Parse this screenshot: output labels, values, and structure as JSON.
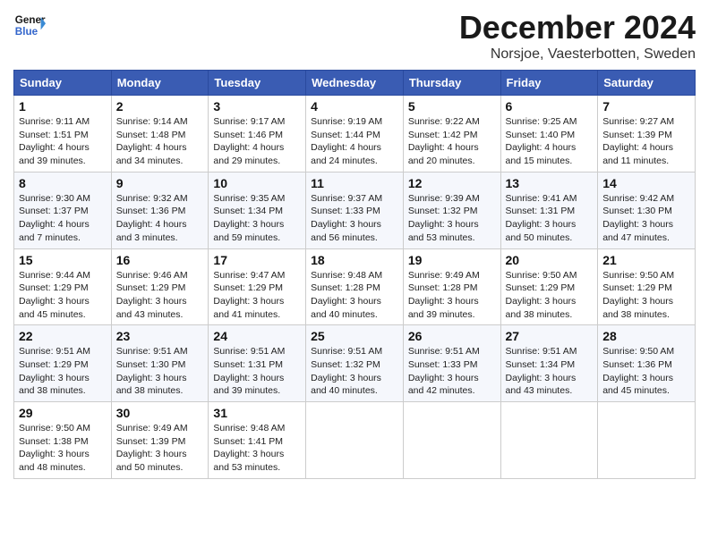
{
  "header": {
    "logo_line1": "General",
    "logo_line2": "Blue",
    "month_year": "December 2024",
    "location": "Norsjoe, Vaesterbotten, Sweden"
  },
  "weekdays": [
    "Sunday",
    "Monday",
    "Tuesday",
    "Wednesday",
    "Thursday",
    "Friday",
    "Saturday"
  ],
  "weeks": [
    [
      {
        "day": "1",
        "info": "Sunrise: 9:11 AM\nSunset: 1:51 PM\nDaylight: 4 hours\nand 39 minutes."
      },
      {
        "day": "2",
        "info": "Sunrise: 9:14 AM\nSunset: 1:48 PM\nDaylight: 4 hours\nand 34 minutes."
      },
      {
        "day": "3",
        "info": "Sunrise: 9:17 AM\nSunset: 1:46 PM\nDaylight: 4 hours\nand 29 minutes."
      },
      {
        "day": "4",
        "info": "Sunrise: 9:19 AM\nSunset: 1:44 PM\nDaylight: 4 hours\nand 24 minutes."
      },
      {
        "day": "5",
        "info": "Sunrise: 9:22 AM\nSunset: 1:42 PM\nDaylight: 4 hours\nand 20 minutes."
      },
      {
        "day": "6",
        "info": "Sunrise: 9:25 AM\nSunset: 1:40 PM\nDaylight: 4 hours\nand 15 minutes."
      },
      {
        "day": "7",
        "info": "Sunrise: 9:27 AM\nSunset: 1:39 PM\nDaylight: 4 hours\nand 11 minutes."
      }
    ],
    [
      {
        "day": "8",
        "info": "Sunrise: 9:30 AM\nSunset: 1:37 PM\nDaylight: 4 hours\nand 7 minutes."
      },
      {
        "day": "9",
        "info": "Sunrise: 9:32 AM\nSunset: 1:36 PM\nDaylight: 4 hours\nand 3 minutes."
      },
      {
        "day": "10",
        "info": "Sunrise: 9:35 AM\nSunset: 1:34 PM\nDaylight: 3 hours\nand 59 minutes."
      },
      {
        "day": "11",
        "info": "Sunrise: 9:37 AM\nSunset: 1:33 PM\nDaylight: 3 hours\nand 56 minutes."
      },
      {
        "day": "12",
        "info": "Sunrise: 9:39 AM\nSunset: 1:32 PM\nDaylight: 3 hours\nand 53 minutes."
      },
      {
        "day": "13",
        "info": "Sunrise: 9:41 AM\nSunset: 1:31 PM\nDaylight: 3 hours\nand 50 minutes."
      },
      {
        "day": "14",
        "info": "Sunrise: 9:42 AM\nSunset: 1:30 PM\nDaylight: 3 hours\nand 47 minutes."
      }
    ],
    [
      {
        "day": "15",
        "info": "Sunrise: 9:44 AM\nSunset: 1:29 PM\nDaylight: 3 hours\nand 45 minutes."
      },
      {
        "day": "16",
        "info": "Sunrise: 9:46 AM\nSunset: 1:29 PM\nDaylight: 3 hours\nand 43 minutes."
      },
      {
        "day": "17",
        "info": "Sunrise: 9:47 AM\nSunset: 1:29 PM\nDaylight: 3 hours\nand 41 minutes."
      },
      {
        "day": "18",
        "info": "Sunrise: 9:48 AM\nSunset: 1:28 PM\nDaylight: 3 hours\nand 40 minutes."
      },
      {
        "day": "19",
        "info": "Sunrise: 9:49 AM\nSunset: 1:28 PM\nDaylight: 3 hours\nand 39 minutes."
      },
      {
        "day": "20",
        "info": "Sunrise: 9:50 AM\nSunset: 1:29 PM\nDaylight: 3 hours\nand 38 minutes."
      },
      {
        "day": "21",
        "info": "Sunrise: 9:50 AM\nSunset: 1:29 PM\nDaylight: 3 hours\nand 38 minutes."
      }
    ],
    [
      {
        "day": "22",
        "info": "Sunrise: 9:51 AM\nSunset: 1:29 PM\nDaylight: 3 hours\nand 38 minutes."
      },
      {
        "day": "23",
        "info": "Sunrise: 9:51 AM\nSunset: 1:30 PM\nDaylight: 3 hours\nand 38 minutes."
      },
      {
        "day": "24",
        "info": "Sunrise: 9:51 AM\nSunset: 1:31 PM\nDaylight: 3 hours\nand 39 minutes."
      },
      {
        "day": "25",
        "info": "Sunrise: 9:51 AM\nSunset: 1:32 PM\nDaylight: 3 hours\nand 40 minutes."
      },
      {
        "day": "26",
        "info": "Sunrise: 9:51 AM\nSunset: 1:33 PM\nDaylight: 3 hours\nand 42 minutes."
      },
      {
        "day": "27",
        "info": "Sunrise: 9:51 AM\nSunset: 1:34 PM\nDaylight: 3 hours\nand 43 minutes."
      },
      {
        "day": "28",
        "info": "Sunrise: 9:50 AM\nSunset: 1:36 PM\nDaylight: 3 hours\nand 45 minutes."
      }
    ],
    [
      {
        "day": "29",
        "info": "Sunrise: 9:50 AM\nSunset: 1:38 PM\nDaylight: 3 hours\nand 48 minutes."
      },
      {
        "day": "30",
        "info": "Sunrise: 9:49 AM\nSunset: 1:39 PM\nDaylight: 3 hours\nand 50 minutes."
      },
      {
        "day": "31",
        "info": "Sunrise: 9:48 AM\nSunset: 1:41 PM\nDaylight: 3 hours\nand 53 minutes."
      },
      null,
      null,
      null,
      null
    ]
  ]
}
